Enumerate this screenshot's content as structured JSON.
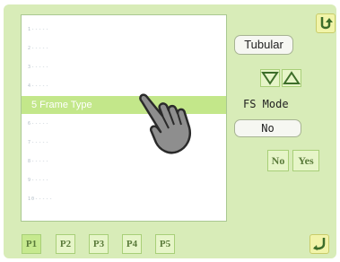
{
  "list": {
    "items": [
      {
        "label": "1-----",
        "selected": false
      },
      {
        "label": "2-----",
        "selected": false
      },
      {
        "label": "3-----",
        "selected": false
      },
      {
        "label": "4-----",
        "selected": false
      },
      {
        "label": "5 Frame Type",
        "selected": true
      },
      {
        "label": "6-----",
        "selected": false
      },
      {
        "label": "7-----",
        "selected": false
      },
      {
        "label": "8-----",
        "selected": false
      },
      {
        "label": "9-----",
        "selected": false
      },
      {
        "label": "10-----",
        "selected": false
      }
    ]
  },
  "controls": {
    "frame_type_value": "Tubular",
    "fs_mode_label": "FS Mode",
    "fs_mode_value": "No",
    "no_label": "No",
    "yes_label": "Yes"
  },
  "tabs": [
    {
      "label": "P1",
      "active": true
    },
    {
      "label": "P2",
      "active": false
    },
    {
      "label": "P3",
      "active": false
    },
    {
      "label": "P4",
      "active": false
    },
    {
      "label": "P5",
      "active": false
    }
  ],
  "icons": {
    "back": "return-arrow-icon",
    "forward": "forward-arrow-icon",
    "down": "down-arrow-icon",
    "up": "up-arrow-icon",
    "pointer": "hand-pointer-icon"
  },
  "colors": {
    "panel_bg": "#d8ecb8",
    "selected_row": "#c3e78a",
    "accent_button": "#e6f5c8"
  }
}
